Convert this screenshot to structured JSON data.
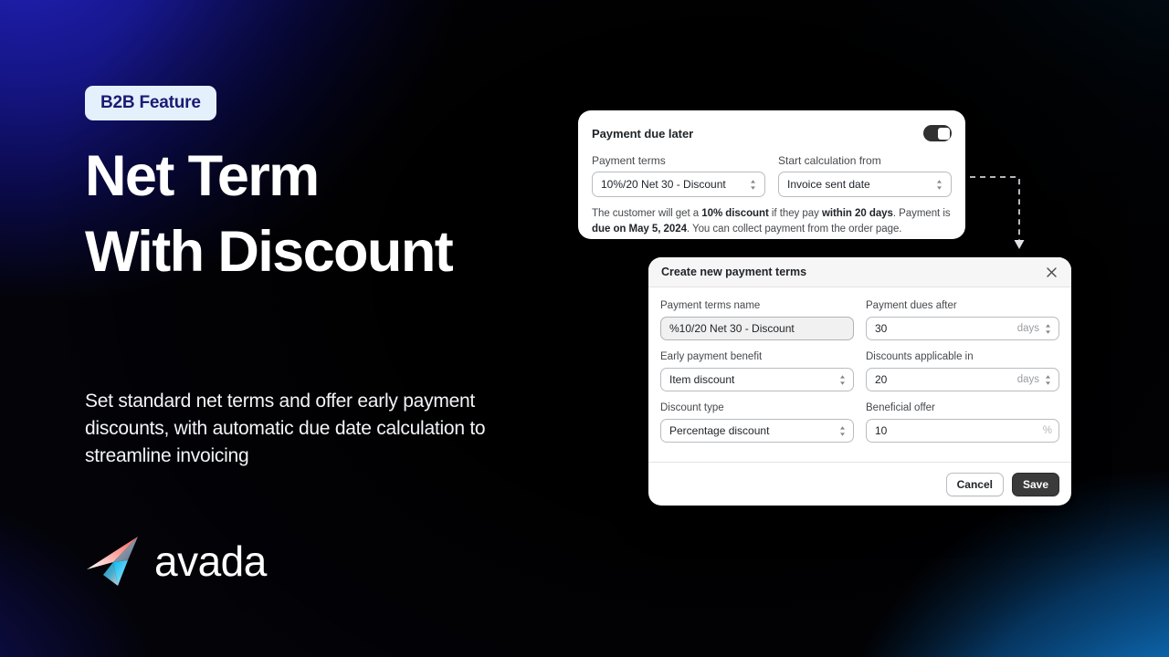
{
  "hero": {
    "badge": "B2B Feature",
    "headline_line1": "Net Term",
    "headline_line2": "With Discount",
    "subcopy": "Set standard net terms and offer early payment discounts, with automatic due date calculation to streamline invoicing",
    "logo_word": "avada",
    "badge_bg": "#e4f0fb",
    "badge_fg": "#1b1b72"
  },
  "payment_due_card": {
    "title": "Payment due later",
    "toggle_state": "on",
    "payment_terms": {
      "label": "Payment terms",
      "value": "10%/20 Net 30 -  Discount"
    },
    "start_calculation": {
      "label": "Start calculation from",
      "value": "Invoice sent date"
    },
    "helper": {
      "part1": "The customer will get a ",
      "bold1": "10% discount",
      "part2": " if they pay ",
      "bold2": "within 20 days",
      "part3": ". Payment is ",
      "bold3": "due on  May 5, 2024",
      "part4": ". You can collect payment from the order page."
    }
  },
  "modal": {
    "title": "Create new payment terms",
    "close_label": "✕",
    "fields": {
      "terms_name": {
        "label": "Payment terms name",
        "value": "%10/20 Net 30 - Discount"
      },
      "dues_after": {
        "label": "Payment dues after",
        "value": "30",
        "suffix": "days"
      },
      "early_benefit": {
        "label": "Early payment benefit",
        "value": "Item discount"
      },
      "discounts_in": {
        "label": "Discounts applicable in",
        "value": "20",
        "suffix": "days"
      },
      "discount_type": {
        "label": "Discount type",
        "value": "Percentage discount"
      },
      "beneficial_offer": {
        "label": "Beneficial offer",
        "value": "10",
        "suffix": "%"
      }
    },
    "cancel_label": "Cancel",
    "save_label": "Save",
    "save_bg": "#3b3b3b"
  }
}
